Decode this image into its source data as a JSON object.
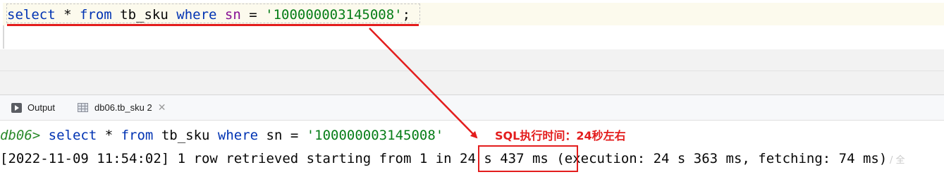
{
  "editor": {
    "query": {
      "kw_select": "select",
      "star": " * ",
      "kw_from": "from",
      "table": " tb_sku ",
      "kw_where": "where",
      "sp1": " ",
      "field": "sn",
      "eq": " = ",
      "value": "'100000003145008'",
      "semi": ";"
    }
  },
  "tabs": [
    {
      "label": "Output",
      "icon": "output-icon"
    },
    {
      "label": "db06.tb_sku 2",
      "icon": "table-icon",
      "close": "✕"
    }
  ],
  "console": {
    "prompt": "db06>",
    "cmd_select": " select",
    "cmd_star": " * ",
    "cmd_from": "from",
    "cmd_table": " tb_sku ",
    "cmd_where": "where",
    "cmd_cond": " sn = ",
    "cmd_value": "'100000003145008'",
    "result_prefix": "[2022-11-09 11:54:02] 1 row retrieved starting from 1 in ",
    "result_time": "24 s 437 ms",
    "result_suffix": " (execution: 24 s 363 ms, fetching: 74 ms)"
  },
  "annotation": {
    "text": "SQL执行时间：24秒左右",
    "color": "#e31d1d"
  },
  "watermark": "/ 全"
}
